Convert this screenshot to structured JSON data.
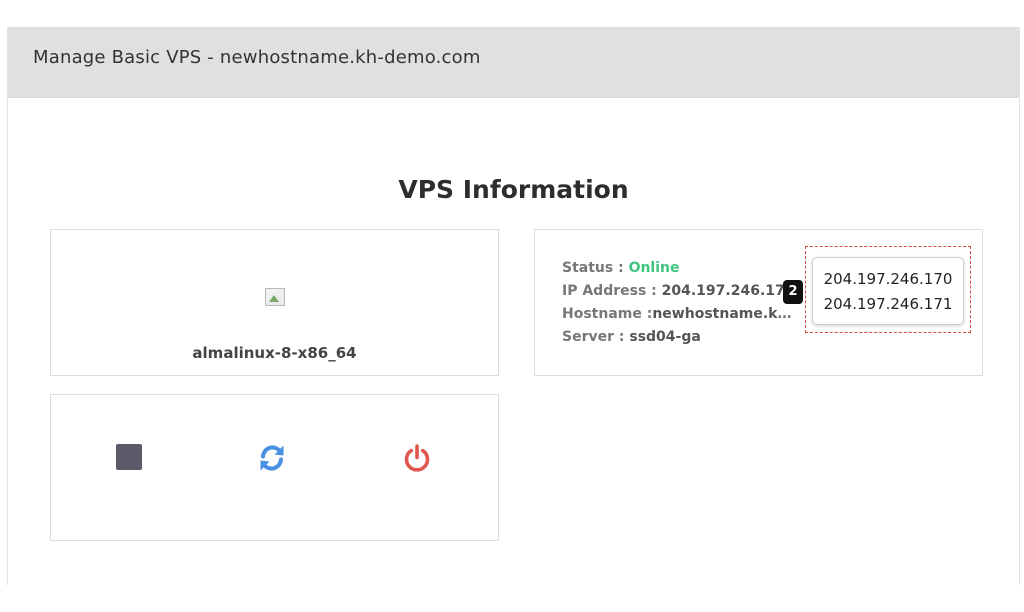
{
  "header": {
    "title": "Manage Basic VPS - newhostname.kh-demo.com"
  },
  "page": {
    "section_title": "VPS Information"
  },
  "os": {
    "name": "almalinux-8-x86_64",
    "image_icon": "broken-image-icon"
  },
  "info": {
    "status_label": "Status : ",
    "status_value": "Online",
    "ip_label": "IP Address : ",
    "ip_value": "204.197.246.170",
    "hostname_label": "Hostname :",
    "hostname_value": "newhostname.kh…",
    "server_label": "Server : ",
    "server_value": "ssd04-ga"
  },
  "annotation": {
    "badge": "2"
  },
  "ip_popup": {
    "ips": [
      "204.197.246.170",
      "204.197.246.171"
    ]
  },
  "controls": {
    "stop_icon": "stop-square-icon",
    "restart_icon": "refresh-icon",
    "power_icon": "power-icon"
  },
  "colors": {
    "online": "#3fc57f",
    "refresh": "#4a90e2",
    "power": "#e0574f",
    "stop": "#5e5968",
    "highlight": "#d24b4b"
  }
}
